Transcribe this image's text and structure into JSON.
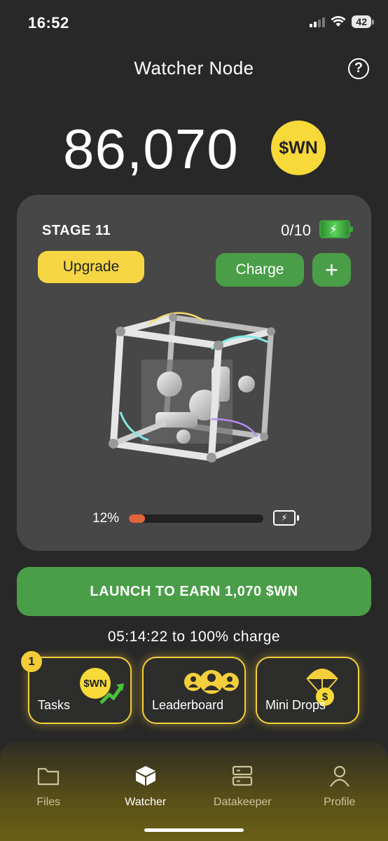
{
  "status": {
    "time": "16:52",
    "battery": "42"
  },
  "header": {
    "title": "Watcher Node",
    "help_label": "?"
  },
  "balance": {
    "amount": "86,070",
    "coin_label": "$WN"
  },
  "stage": {
    "label": "STAGE 11",
    "charges": "0/10",
    "upgrade_label": "Upgrade",
    "charge_label": "Charge",
    "plus_label": "+",
    "progress": {
      "text": "12%",
      "value": 0.12
    }
  },
  "launch": {
    "label": "LAUNCH TO EARN 1,070 $WN",
    "timer": "05:14:22 to 100% charge"
  },
  "actions": [
    {
      "label": "Tasks",
      "badge": "1",
      "coin": "$WN"
    },
    {
      "label": "Leaderboard"
    },
    {
      "label": "Mini Drops",
      "coin": "$"
    }
  ],
  "tabs": [
    {
      "label": "Files",
      "icon": "folder-icon"
    },
    {
      "label": "Watcher",
      "icon": "cube-icon",
      "active": true
    },
    {
      "label": "Datakeeper",
      "icon": "server-icon"
    },
    {
      "label": "Profile",
      "icon": "person-icon"
    }
  ],
  "colors": {
    "accent_yellow": "#f6d743",
    "accent_green": "#4a9e48",
    "progress": "#e2643a",
    "card": "#474747",
    "background": "#282828"
  }
}
